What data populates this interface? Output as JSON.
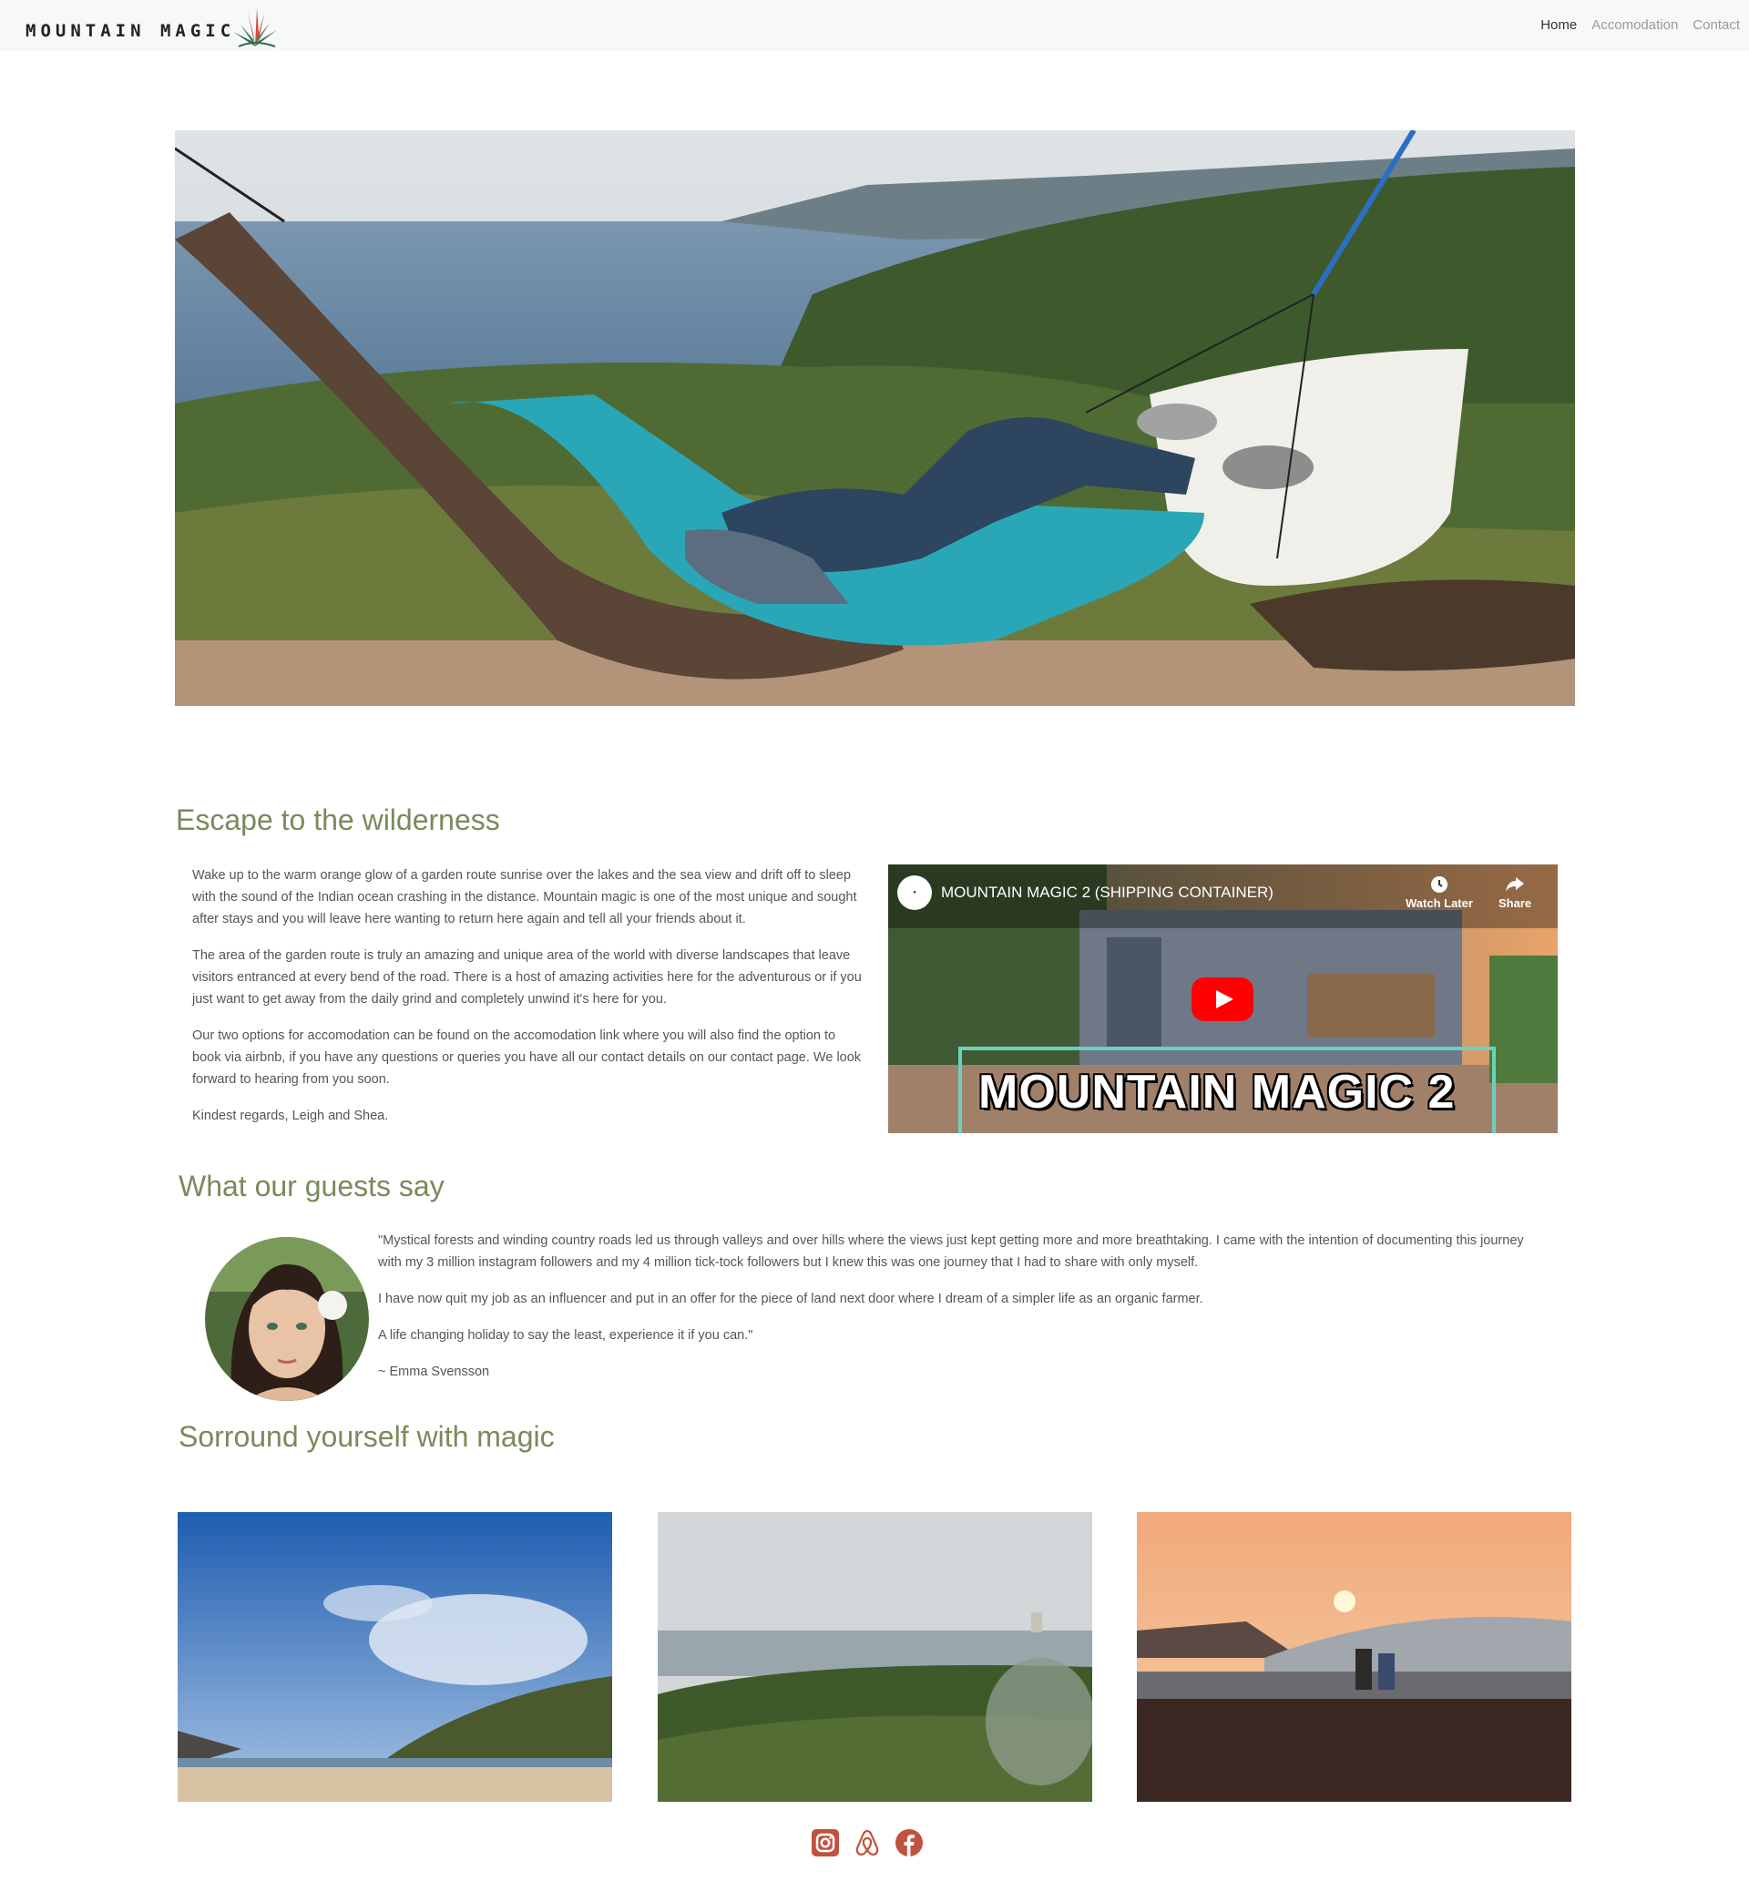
{
  "nav": {
    "logo_text": "MOUNTAIN MAGIC",
    "links": [
      {
        "label": "Home",
        "active": true
      },
      {
        "label": "Accomodation",
        "active": false
      },
      {
        "label": "Contact",
        "active": false
      }
    ]
  },
  "intro": {
    "title": "Escape to the wilderness",
    "paragraphs": [
      "Wake up to the warm orange glow of a garden route sunrise over the lakes and the sea view and drift off to sleep with the sound of the Indian ocean crashing in the distance. Mountain magic is one of the most unique and sought after stays and you will leave here wanting to return here again and tell all your friends about it.",
      "The area of the garden route is truly an amazing and unique area of the world with diverse landscapes that leave visitors entranced at every bend of the road. There is a host of amazing activities here for the adventurous or if you just want to get away from the daily grind and completely unwind it's here for you.",
      "Our two options for accomodation can be found on the accomodation link where you will also find the option to book via airbnb, if you have any questions or queries you have all our contact details on our contact page. We look forward to hearing from you soon.",
      "Kindest regards, Leigh and Shea."
    ]
  },
  "video": {
    "title": "MOUNTAIN MAGIC 2 (SHIPPING CONTAINER)",
    "watch_later": "Watch Later",
    "share": "Share",
    "banner": "MOUNTAIN MAGIC 2"
  },
  "testimonials": {
    "title": "What our guests say",
    "paragraphs": [
      "\"Mystical forests and winding country roads led us through valleys and over hills where the views just kept getting more and more breathtaking. I came with the intention of documenting this journey with my 3 million instagram followers and my 4 million tick-tock followers but I knew this was one journey that I had to share with only myself.",
      "I have now quit my job as an influencer and put in an offer for the piece of land next door where I dream of a simpler life as an organic farmer.",
      "A life changing holiday to say the least, experience it if you can.\"",
      "~ Emma Svensson"
    ]
  },
  "gallery": {
    "title": "Sorround yourself with magic"
  },
  "colors": {
    "accent_green": "#7a8a5c",
    "social_red": "#c0523e",
    "nav_bg": "#f7f8fa"
  },
  "social": [
    "instagram-icon",
    "airbnb-icon",
    "facebook-icon"
  ]
}
